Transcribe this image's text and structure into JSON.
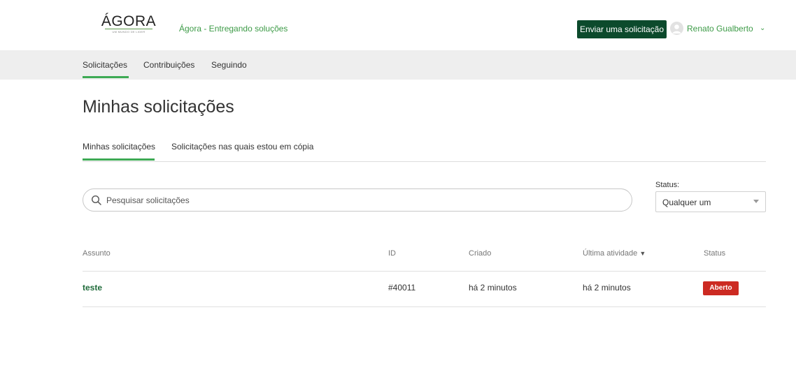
{
  "header": {
    "logo_text": "ÁGORA",
    "logo_subtext": "UM MUNDO DE LIDER",
    "brand_link": "Ágora - Entregando soluções",
    "submit_button": "Enviar uma solicitação",
    "user_name": "Renato Gualberto",
    "user_chevron": "⌄"
  },
  "subnav": {
    "items": [
      {
        "label": "Solicitações",
        "active": true
      },
      {
        "label": "Contribuições",
        "active": false
      },
      {
        "label": "Seguindo",
        "active": false
      }
    ]
  },
  "page": {
    "title": "Minhas solicitações"
  },
  "tabs": [
    {
      "label": "Minhas solicitações",
      "active": true
    },
    {
      "label": "Solicitações nas quais estou em cópia",
      "active": false
    }
  ],
  "search": {
    "placeholder": "Pesquisar solicitações",
    "value": ""
  },
  "status_filter": {
    "label": "Status:",
    "selected": "Qualquer um"
  },
  "table": {
    "columns": [
      "Assunto",
      "ID",
      "Criado",
      "Última atividade",
      "Status"
    ],
    "sort_indicator": "▼",
    "rows": [
      {
        "subject": "teste",
        "id": "#40011",
        "created": "há 2 minutos",
        "last_activity": "há 2 minutos",
        "status": "Aberto"
      }
    ]
  },
  "colors": {
    "accent_green": "#3daa54",
    "button_dark_green": "#0c4a2c",
    "link_green": "#3d9b47",
    "status_open_red": "#cc2a22",
    "subnav_bg": "#eeeeee"
  },
  "icons": [
    "search-icon",
    "user-avatar-icon",
    "chevron-down-icon",
    "sort-desc-icon",
    "select-arrow-icon"
  ]
}
